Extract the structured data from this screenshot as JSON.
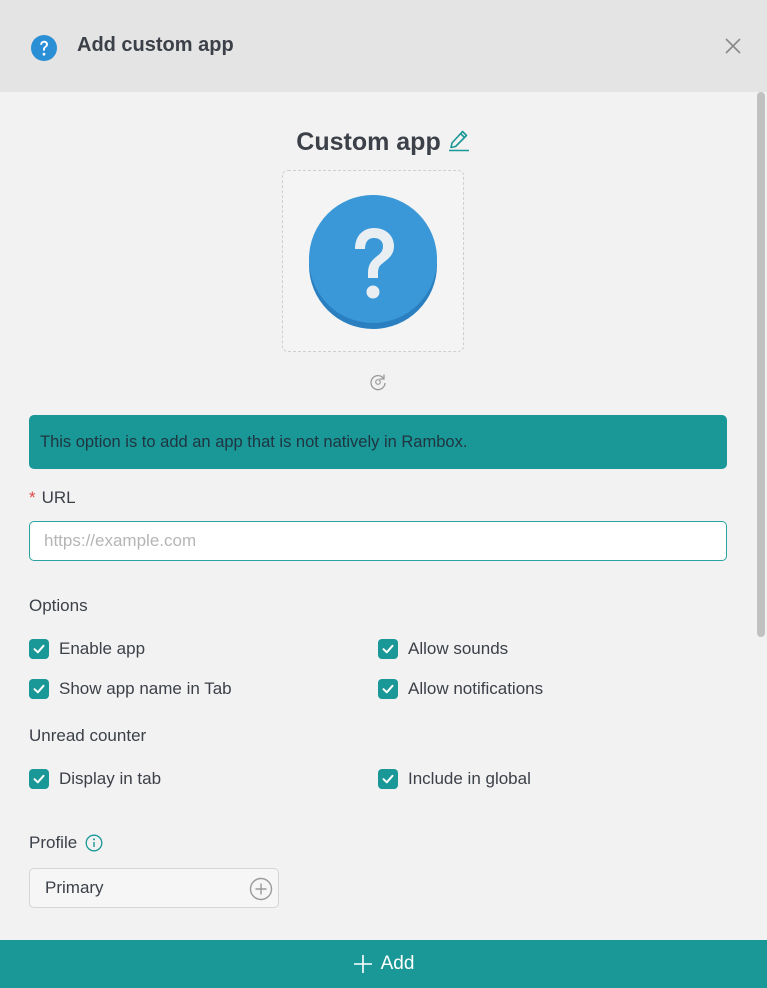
{
  "dialog": {
    "title": "Add custom app",
    "header_icon": "question-circle-icon",
    "close_icon": "close-icon"
  },
  "app": {
    "name": "Custom app",
    "edit_icon": "pencil-icon",
    "logo_icon": "question-mark-icon",
    "reset_icon": "reset-icon"
  },
  "banner": {
    "text": "This option is to add an app that is not natively in Rambox."
  },
  "url": {
    "required_mark": "*",
    "label": "URL",
    "value": "",
    "placeholder": "https://example.com"
  },
  "options": {
    "label": "Options",
    "items": [
      {
        "label": "Enable app",
        "checked": true
      },
      {
        "label": "Allow sounds",
        "checked": true
      },
      {
        "label": "Show app name in Tab",
        "checked": true
      },
      {
        "label": "Allow notifications",
        "checked": true
      }
    ]
  },
  "unread": {
    "label": "Unread counter",
    "items": [
      {
        "label": "Display in tab",
        "checked": true
      },
      {
        "label": "Include in global",
        "checked": true
      }
    ]
  },
  "profile": {
    "label": "Profile",
    "info_icon": "info-icon",
    "selected": "Primary",
    "add_icon": "plus-circle-icon"
  },
  "footer": {
    "add_label": "Add",
    "add_icon": "plus-icon"
  },
  "colors": {
    "accent": "#1a9797",
    "logo_blue": "#3a98d8",
    "header_bg": "#e4e4e4",
    "body_bg": "#f2f2f2"
  }
}
